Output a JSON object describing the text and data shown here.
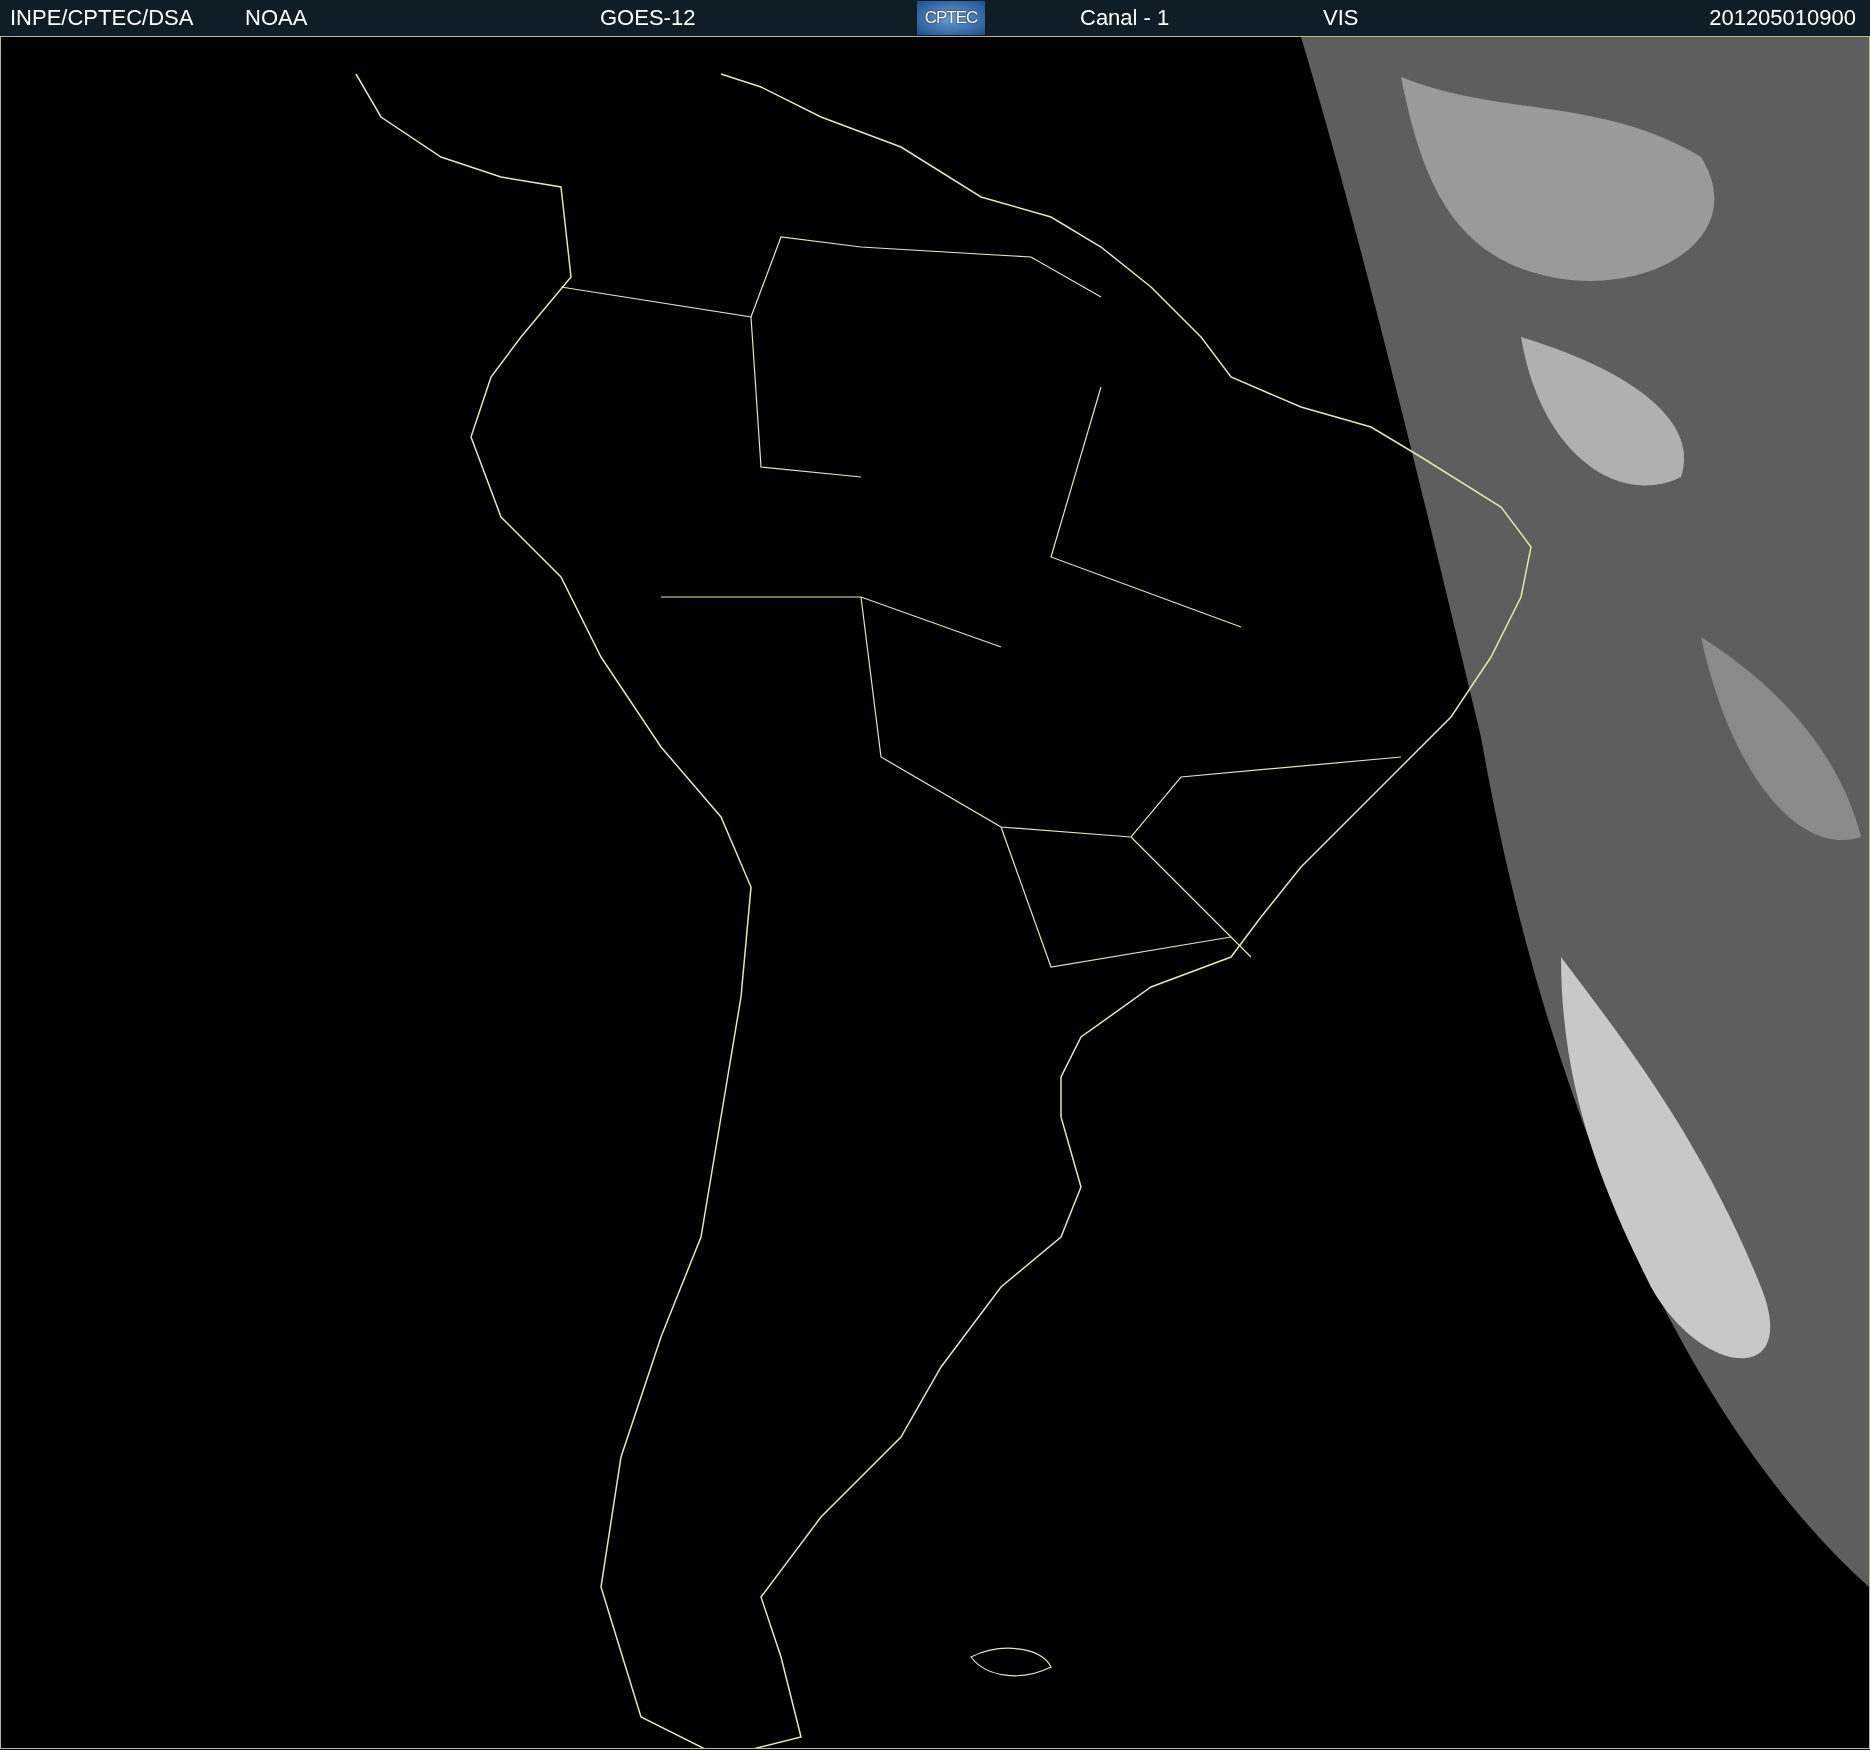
{
  "header": {
    "source": "INPE/CPTEC/DSA",
    "agency": "NOAA",
    "satellite": "GOES-12",
    "logo": "CPTEC",
    "channel": "Canal - 1",
    "band": "VIS",
    "timestamp": "201205010900"
  }
}
